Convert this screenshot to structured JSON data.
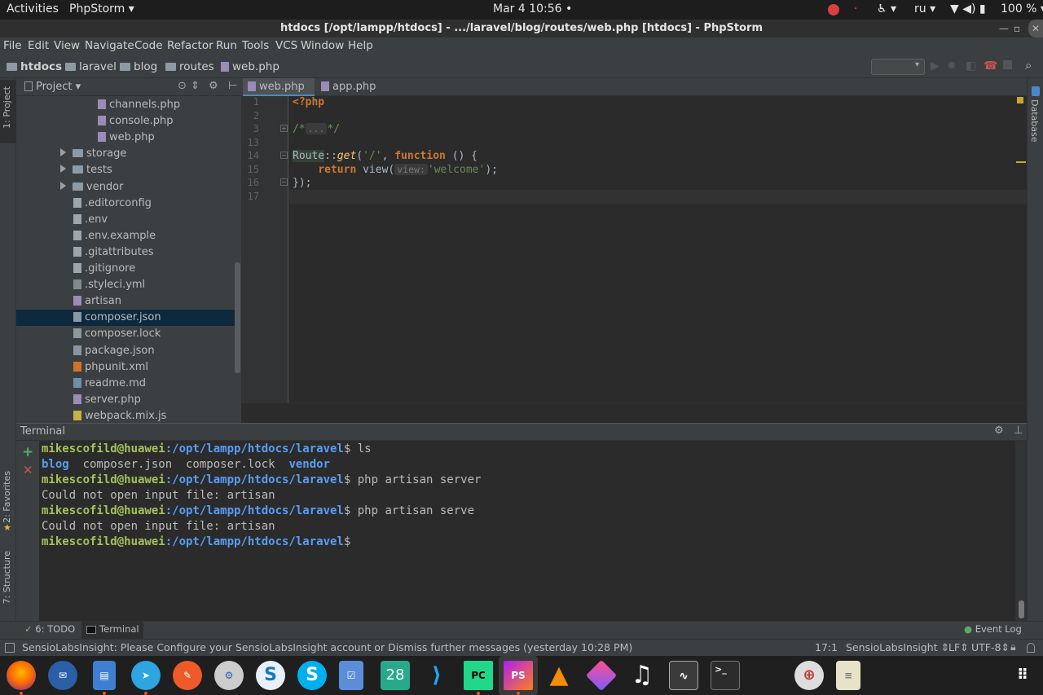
{
  "system_bar": {
    "activities": "Activities",
    "app_name": "PhpStorm ▾",
    "clock": "Mar 4  10:56 •",
    "language": "ru ▾",
    "battery": "100 % ▾"
  },
  "window": {
    "title": "htdocs [/opt/lampp/htdocs] - .../laravel/blog/routes/web.php [htdocs] - PhpStorm"
  },
  "menu": [
    "File",
    "Edit",
    "View",
    "Navigate",
    "Code",
    "Refactor",
    "Run",
    "Tools",
    "VCS",
    "Window",
    "Help"
  ],
  "breadcrumbs": [
    "htdocs",
    "laravel",
    "blog",
    "routes",
    "web.php"
  ],
  "left_strip": {
    "project": "1: Project",
    "favorites": "2: Favorites",
    "structure": "7: Structure"
  },
  "right_strip": {
    "database": "Database"
  },
  "project_panel": {
    "title": "Project ▾",
    "items": [
      {
        "label": "channels.php",
        "indent": 2,
        "kind": "php"
      },
      {
        "label": "console.php",
        "indent": 2,
        "kind": "php"
      },
      {
        "label": "web.php",
        "indent": 2,
        "kind": "php"
      },
      {
        "label": "storage",
        "indent": 1,
        "kind": "folder"
      },
      {
        "label": "tests",
        "indent": 1,
        "kind": "folder"
      },
      {
        "label": "vendor",
        "indent": 1,
        "kind": "folder"
      },
      {
        "label": ".editorconfig",
        "indent": 1,
        "kind": "file"
      },
      {
        "label": ".env",
        "indent": 1,
        "kind": "file"
      },
      {
        "label": ".env.example",
        "indent": 1,
        "kind": "file"
      },
      {
        "label": ".gitattributes",
        "indent": 1,
        "kind": "file"
      },
      {
        "label": ".gitignore",
        "indent": 1,
        "kind": "file"
      },
      {
        "label": ".styleci.yml",
        "indent": 1,
        "kind": "yml"
      },
      {
        "label": "artisan",
        "indent": 1,
        "kind": "php"
      },
      {
        "label": "composer.json",
        "indent": 1,
        "kind": "json",
        "selected": true
      },
      {
        "label": "composer.lock",
        "indent": 1,
        "kind": "json"
      },
      {
        "label": "package.json",
        "indent": 1,
        "kind": "json"
      },
      {
        "label": "phpunit.xml",
        "indent": 1,
        "kind": "xml"
      },
      {
        "label": "readme.md",
        "indent": 1,
        "kind": "md"
      },
      {
        "label": "server.php",
        "indent": 1,
        "kind": "php"
      },
      {
        "label": "webpack.mix.js",
        "indent": 1,
        "kind": "js"
      }
    ]
  },
  "editor": {
    "tabs": [
      {
        "label": "web.php",
        "active": true
      },
      {
        "label": "app.php",
        "active": false
      }
    ],
    "line_numbers": [
      "1",
      "2",
      "3",
      "13",
      "14",
      "15",
      "16",
      "17"
    ],
    "code": {
      "l1": "<?php",
      "l3_open": "/*",
      "l3_fold": "...",
      "l3_close": "*/",
      "l14_class": "Route",
      "l14_sep": "::",
      "l14_method": "get",
      "l14_args_open": "(",
      "l14_str": "'/'",
      "l14_comma": ", ",
      "l14_kw": "function",
      "l14_rest": " () {",
      "l15_kw": "return",
      "l15_fn": " view(",
      "l15_hint": "view:",
      "l15_str": "'welcome'",
      "l15_end": ");",
      "l16": "});"
    }
  },
  "terminal": {
    "title": "Terminal",
    "lines": [
      {
        "user": "mikescofild@huawei",
        "path": ":/opt/lampp/htdocs/laravel",
        "cmd": "$ ls"
      },
      {
        "output_dir": "blog",
        "output_files": "  composer.json  composer.lock  ",
        "output_dir2": "vendor"
      },
      {
        "user": "mikescofild@huawei",
        "path": ":/opt/lampp/htdocs/laravel",
        "cmd": "$ php artisan server"
      },
      {
        "output": "Could not open input file: artisan"
      },
      {
        "user": "mikescofild@huawei",
        "path": ":/opt/lampp/htdocs/laravel",
        "cmd": "$ php artisan serve"
      },
      {
        "output": "Could not open input file: artisan"
      },
      {
        "user": "mikescofild@huawei",
        "path": ":/opt/lampp/htdocs/laravel",
        "cmd": "$"
      }
    ]
  },
  "bottom_tabs": {
    "todo": "6: TODO",
    "terminal": "Terminal",
    "event_log": "Event Log"
  },
  "status_bar": {
    "message": "SensioLabsInsight: Please Configure your SensioLabsInsight account or Dismiss further messages (yesterday 10:28 PM)",
    "position": "17:1",
    "insight": "SensioLabsInsight ⇕",
    "line_sep": "LF⇕",
    "encoding": "UTF-8⇕"
  },
  "dock": {
    "calendar_day": "28",
    "pycharm": "PC",
    "phpstorm": "PS"
  }
}
